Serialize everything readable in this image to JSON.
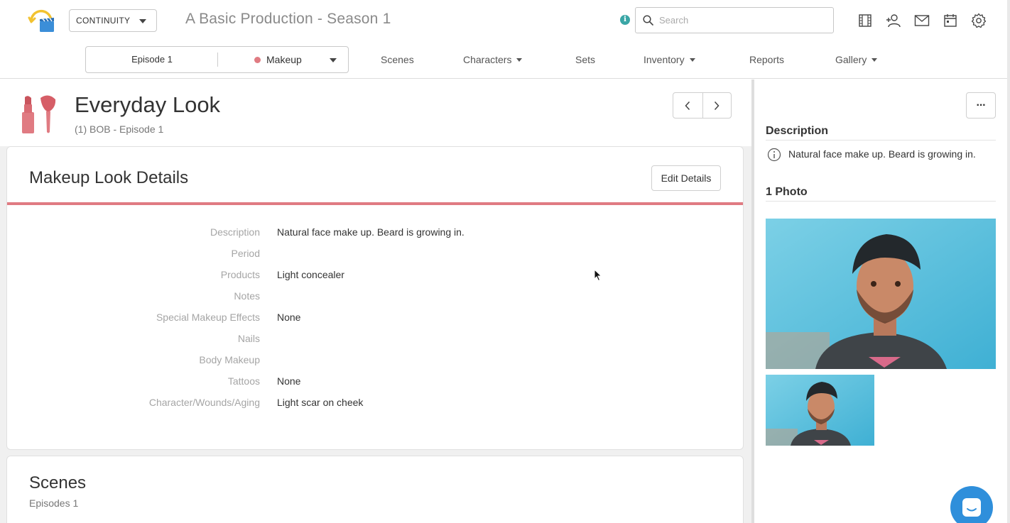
{
  "header": {
    "app_selector": "CONTINUITY",
    "production_title": "A Basic Production - Season 1",
    "info_badge": "i",
    "search_placeholder": "Search",
    "icons": [
      "film-icon",
      "add-user-icon",
      "mail-icon",
      "calendar-icon",
      "gear-icon"
    ]
  },
  "nav": {
    "episode": "Episode 1",
    "category": "Makeup",
    "category_color": "#e07b82",
    "items": [
      {
        "label": "Scenes",
        "dropdown": false
      },
      {
        "label": "Characters",
        "dropdown": true
      },
      {
        "label": "Sets",
        "dropdown": false
      },
      {
        "label": "Inventory",
        "dropdown": true
      },
      {
        "label": "Reports",
        "dropdown": false
      },
      {
        "label": "Gallery",
        "dropdown": true
      }
    ]
  },
  "look": {
    "title": "Everyday Look",
    "subtitle": "(1) BOB - Episode 1"
  },
  "details": {
    "title": "Makeup Look Details",
    "edit_label": "Edit Details",
    "accent_color": "#e07b82",
    "fields": [
      {
        "label": "Description",
        "value": "Natural face make up. Beard is growing in."
      },
      {
        "label": "Period",
        "value": ""
      },
      {
        "label": "Products",
        "value": "Light concealer"
      },
      {
        "label": "Notes",
        "value": ""
      },
      {
        "label": "Special Makeup Effects",
        "value": "None"
      },
      {
        "label": "Nails",
        "value": ""
      },
      {
        "label": "Body Makeup",
        "value": ""
      },
      {
        "label": "Tattoos",
        "value": "None"
      },
      {
        "label": "Character/Wounds/Aging",
        "value": "Light scar on cheek"
      }
    ]
  },
  "scenes": {
    "title": "Scenes",
    "subtitle": "Episodes 1"
  },
  "side": {
    "more_label": "···",
    "description_heading": "Description",
    "description_text": "Natural face make up. Beard is growing in.",
    "photos_heading": "1 Photo"
  }
}
